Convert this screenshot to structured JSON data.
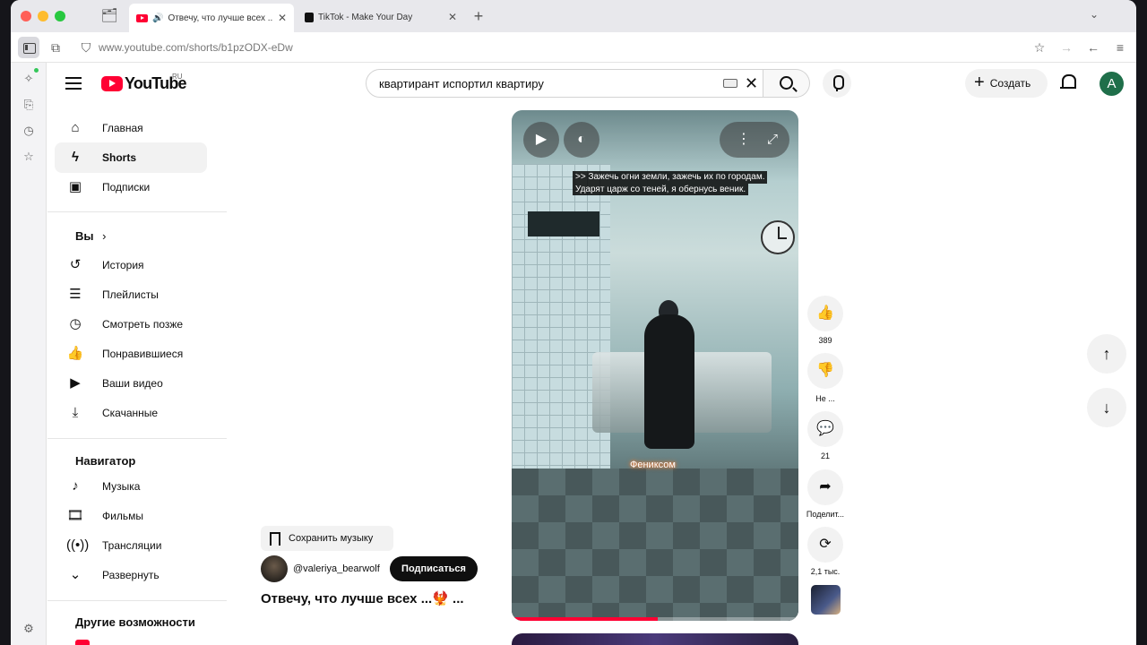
{
  "browser": {
    "tabs": [
      {
        "title": "Отвечу, что лучше всех ...",
        "active": true
      },
      {
        "title": "TikTok - Make Your Day",
        "active": false
      }
    ],
    "url": "www.youtube.com/shorts/b1pzODX-eDw"
  },
  "youtube": {
    "logo_text": "YouTube",
    "country_code": "RU",
    "search": {
      "value": "квартирант испортил квартиру"
    },
    "create_label": "Создать",
    "avatar_letter": "A"
  },
  "sidebar": {
    "main": [
      {
        "label": "Главная",
        "icon": "home-icon"
      },
      {
        "label": "Shorts",
        "icon": "shorts-icon",
        "active": true
      },
      {
        "label": "Подписки",
        "icon": "subscriptions-icon"
      }
    ],
    "you_heading": "Вы",
    "you": [
      {
        "label": "История",
        "icon": "history-icon"
      },
      {
        "label": "Плейлисты",
        "icon": "playlists-icon"
      },
      {
        "label": "Смотреть позже",
        "icon": "watch-later-icon"
      },
      {
        "label": "Понравившиеся",
        "icon": "like-icon"
      },
      {
        "label": "Ваши видео",
        "icon": "your-videos-icon"
      },
      {
        "label": "Скачанные",
        "icon": "download-icon"
      }
    ],
    "explore_heading": "Навигатор",
    "explore": [
      {
        "label": "Музыка",
        "icon": "music-icon"
      },
      {
        "label": "Фильмы",
        "icon": "movies-icon"
      },
      {
        "label": "Трансляции",
        "icon": "live-icon"
      },
      {
        "label": "Развернуть",
        "icon": "chevron-down-icon"
      }
    ],
    "more_heading": "Другие возможности"
  },
  "short": {
    "caption_line1": ">> Зажечь огни земли, зажечь их по городам.",
    "caption_line2": "Ударят царж со теней, я обернусь веник.",
    "overlay_word": "Фениксом",
    "progress": 0.51,
    "save_music": "Сохранить музыку",
    "channel": "@valeriya_bearwolf",
    "subscribe": "Подписаться",
    "title": "Отвечу, что лучше всех ...🐦‍🔥 ..."
  },
  "actions": {
    "likes": "389",
    "dislike_label": "Не ...",
    "comments": "21",
    "share_label": "Поделит...",
    "remix_count": "2,1 тыс."
  }
}
